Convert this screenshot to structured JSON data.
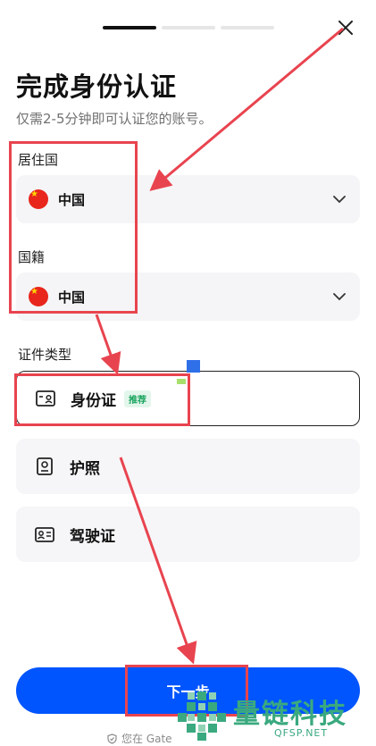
{
  "header": {
    "progress_steps": 3,
    "progress_active_step": 1
  },
  "page": {
    "title": "完成身份认证",
    "subtitle": "仅需2-5分钟即可认证您的账号。"
  },
  "residence": {
    "label": "居住国",
    "value": "中国"
  },
  "nationality": {
    "label": "国籍",
    "value": "中国"
  },
  "id_type": {
    "label": "证件类型",
    "options": [
      {
        "label": "身份证",
        "badge": "推荐",
        "selected": true
      },
      {
        "label": "护照",
        "selected": false
      },
      {
        "label": "驾驶证",
        "selected": false
      }
    ]
  },
  "actions": {
    "next_label": "下一步"
  },
  "footer": {
    "notice": "您在 Gate"
  },
  "watermark": {
    "name": "量链科技",
    "url": "QFSP.NET"
  },
  "colors": {
    "primary": "#0055ff",
    "annotation": "#e8444f",
    "badge_green": "#1aa45e",
    "watermark_green": "#3aa97f"
  }
}
